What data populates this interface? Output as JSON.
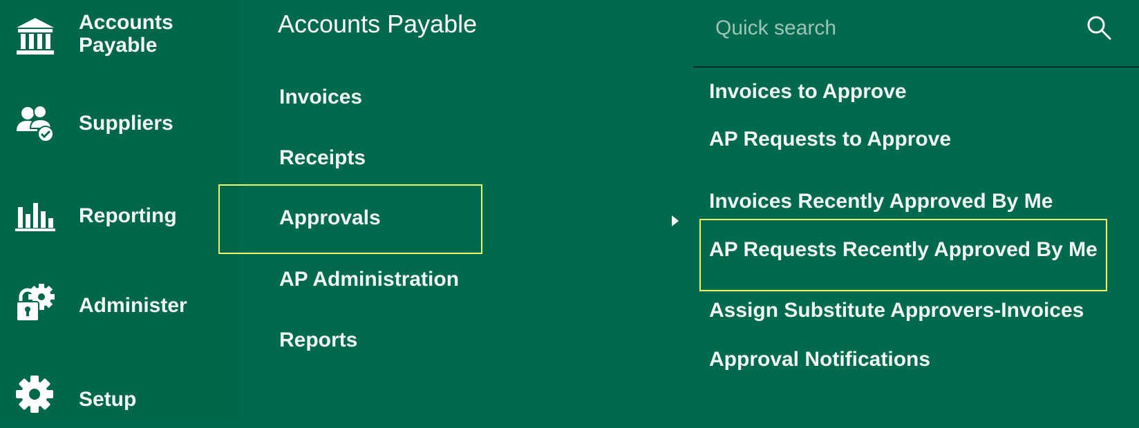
{
  "sidebar": {
    "items": [
      {
        "label_line1": "Accounts",
        "label_line2": "Payable",
        "icon": "bank-icon"
      },
      {
        "label": "Suppliers",
        "icon": "suppliers-icon"
      },
      {
        "label": "Reporting",
        "icon": "bar-chart-icon"
      },
      {
        "label": "Administer",
        "icon": "lock-gear-icon"
      },
      {
        "label": "Setup",
        "icon": "gear-icon"
      }
    ]
  },
  "middle": {
    "title": "Accounts Payable",
    "items": [
      "Invoices",
      "Receipts",
      "Approvals",
      "AP Administration",
      "Reports"
    ],
    "selected": "Approvals"
  },
  "search": {
    "placeholder": "Quick search",
    "icon": "search-icon"
  },
  "submenu": {
    "items": [
      "Invoices to Approve",
      "AP Requests to Approve",
      "Invoices Recently Approved By Me",
      "AP Requests Recently Approved By Me",
      "Assign Substitute Approvers-Invoices",
      "Approval Notifications"
    ],
    "highlighted": "AP Requests Recently Approved By Me"
  },
  "colors": {
    "background": "#006a4e",
    "sidebar": "#00674b",
    "highlight_border": "#f1f56a",
    "text": "#f2f7f4",
    "placeholder": "#9fc4b6"
  }
}
